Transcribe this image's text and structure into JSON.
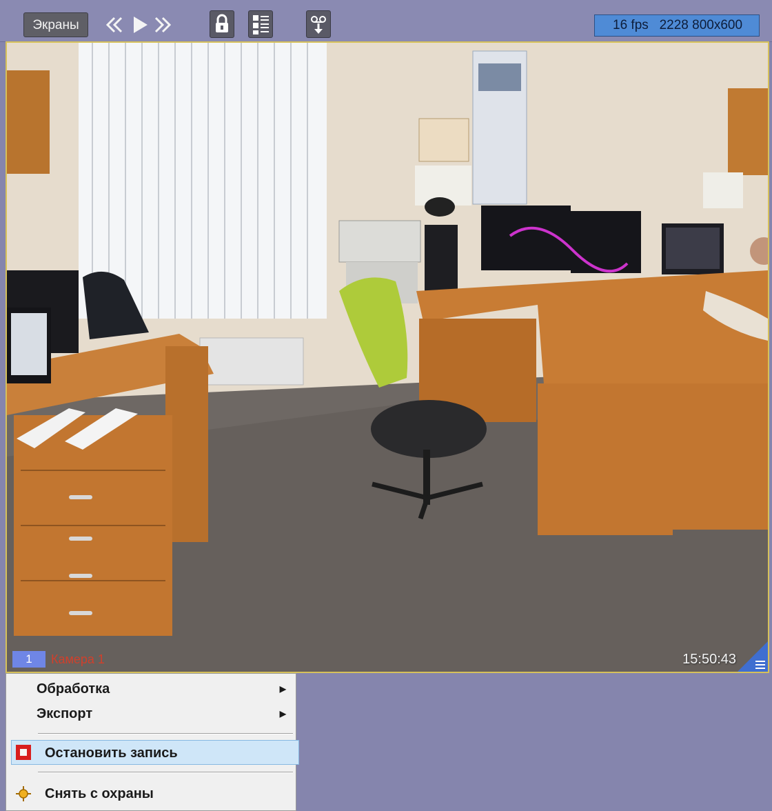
{
  "toolbar": {
    "screens_label": "Экраны",
    "status_text": "16 fps   2228 800x600"
  },
  "video": {
    "camera_number": "1",
    "camera_name": "Камера 1",
    "timestamp": "15:50:43"
  },
  "context_menu": {
    "items": [
      {
        "label": "Обработка",
        "has_submenu": true
      },
      {
        "label": "Экспорт",
        "has_submenu": true
      },
      {
        "label": "Остановить запись",
        "icon": "stop-record-icon",
        "highlighted": true
      },
      {
        "label": "Снять с охраны",
        "icon": "disarm-icon"
      }
    ]
  },
  "colors": {
    "background": "#8585ad",
    "status_box": "#4f8bd6",
    "camera_number_bg": "#6f86e6",
    "camera_name": "#d0402c",
    "viewport_border": "#d6c15a",
    "menu_highlight": "#cfe6f8"
  }
}
